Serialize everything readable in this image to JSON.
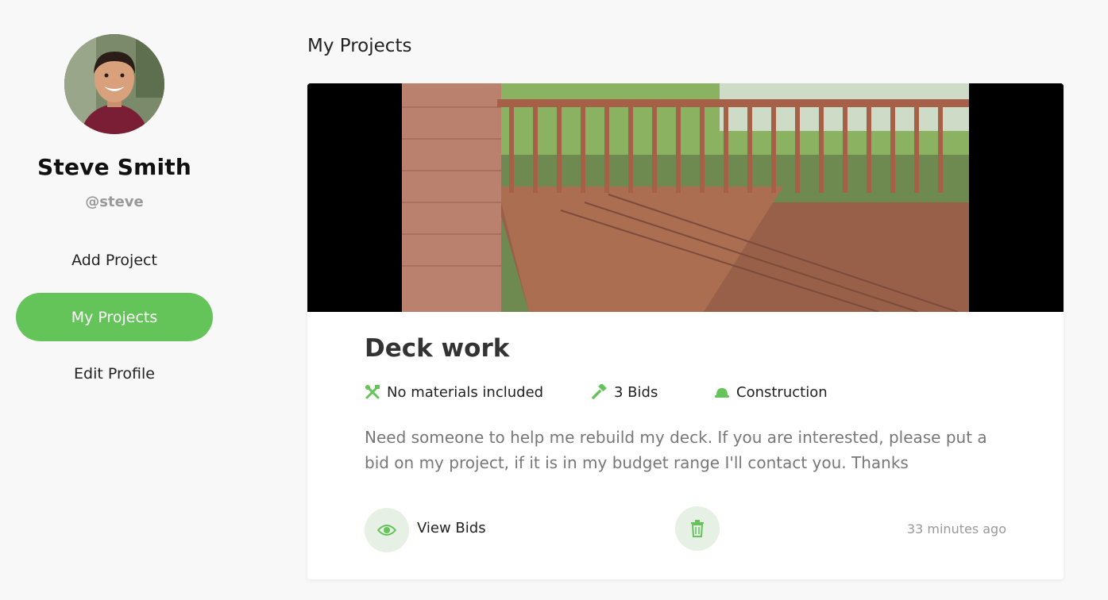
{
  "profile": {
    "name": "Steve Smith",
    "handle": "@steve"
  },
  "nav": {
    "items": [
      {
        "label": "Add Project",
        "active": false
      },
      {
        "label": "My Projects",
        "active": true
      },
      {
        "label": "Edit Profile",
        "active": false
      }
    ]
  },
  "main": {
    "title": "My Projects",
    "project": {
      "title": "Deck work",
      "materials": "No materials included",
      "bids": "3 Bids",
      "category": "Construction",
      "description": "Need someone to help me rebuild my deck. If you are interested, please put a bid on my project, if it is in my budget range I'll contact you. Thanks",
      "view_bids_label": "View Bids",
      "timestamp": "33 minutes ago",
      "image_icon": "deck-photo",
      "materials_icon": "tools-icon",
      "bids_icon": "gavel-icon",
      "category_icon": "hard-hat-icon",
      "view_icon": "eye-icon",
      "delete_icon": "trash-icon"
    }
  },
  "colors": {
    "accent": "#64c459",
    "button_bg": "#e7f0e4"
  }
}
